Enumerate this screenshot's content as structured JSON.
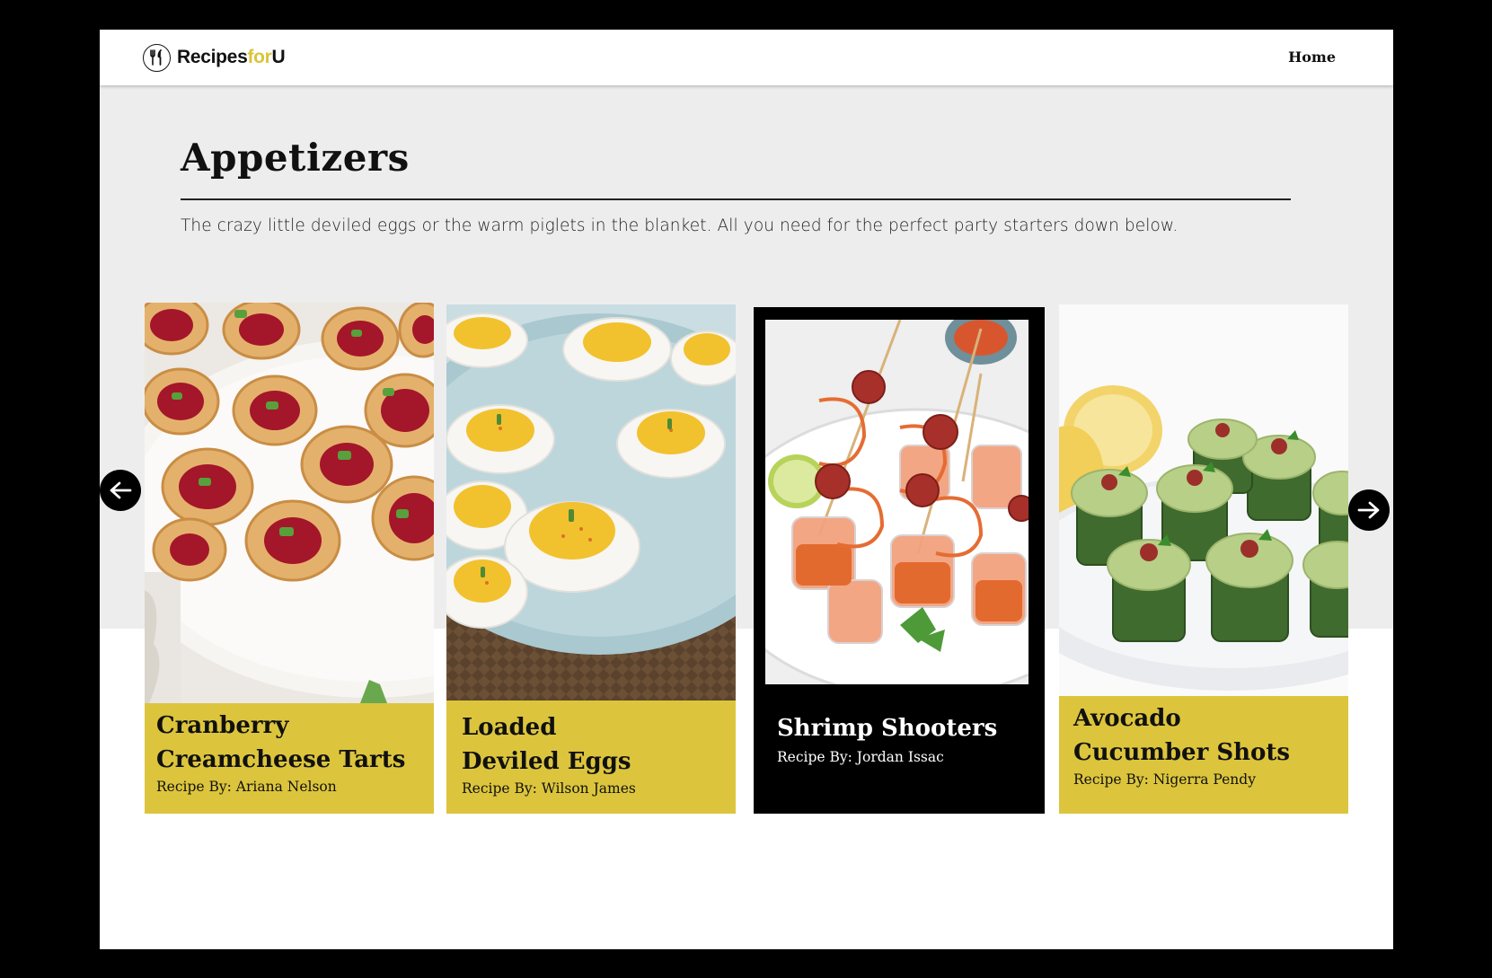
{
  "brand": {
    "name_part1": "Recipes",
    "name_part2": "for",
    "name_part3": "U",
    "accent_color": "#dbc43b"
  },
  "nav": {
    "home_label": "Home"
  },
  "page": {
    "title": "Appetizers",
    "description": "The crazy little deviled eggs or the warm piglets in the blanket. All you need for the perfect party starters down below."
  },
  "cards": [
    {
      "title": "Cranberry\nCreamcheese Tarts",
      "author": "Recipe By: Ariana Nelson",
      "theme": "yellow"
    },
    {
      "title": "Loaded\nDeviled Eggs",
      "author": "Recipe By: Wilson James",
      "theme": "yellow"
    },
    {
      "title": "Shrimp Shooters",
      "author": "Recipe By: Jordan Issac",
      "theme": "dark"
    },
    {
      "title": "Avocado\nCucumber Shots",
      "author": "Recipe By: Nigerra Pendy",
      "theme": "yellow"
    }
  ],
  "carousel": {
    "prev_icon": "arrow-left-icon",
    "next_icon": "arrow-right-icon"
  },
  "colors": {
    "card_yellow": "#dcc53c",
    "hero_bg": "#eeedee",
    "dark_card": "#000000"
  }
}
